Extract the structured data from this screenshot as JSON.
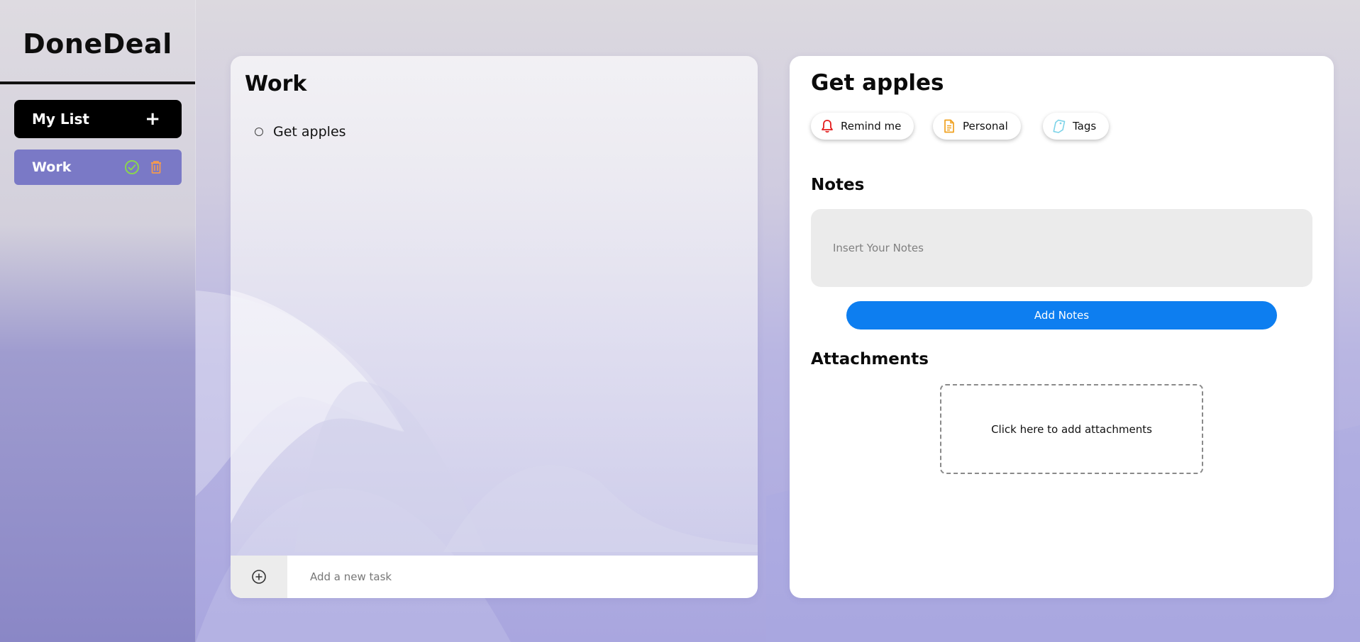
{
  "colors": {
    "sidebar_active": "#7a79c6",
    "primary_button": "#0d7ef0",
    "check_icon": "#8ad54f",
    "trash_icon": "#f39a4f",
    "bell_icon": "#e31b1b",
    "doc_icon": "#f0a120",
    "tag_icon": "#7dd3e8"
  },
  "app": {
    "brand": "DoneDeal"
  },
  "sidebar": {
    "mylist_label": "My List",
    "mylist_plus": "+",
    "lists": [
      {
        "label": "Work",
        "icons": [
          "check-circle-icon",
          "trash-icon"
        ]
      }
    ]
  },
  "tasks_panel": {
    "title": "Work",
    "tasks": [
      {
        "text": "Get apples",
        "done": false
      }
    ],
    "add_placeholder": "Add a new task",
    "add_icon": "plus-circle-icon"
  },
  "detail_panel": {
    "title": "Get apples",
    "chips": [
      {
        "label": "Remind me",
        "icon": "bell-icon"
      },
      {
        "label": "Personal",
        "icon": "document-icon"
      },
      {
        "label": "Tags",
        "icon": "tag-icon"
      }
    ],
    "notes_heading": "Notes",
    "notes_placeholder": "Insert Your Notes",
    "add_notes_label": "Add Notes",
    "attachments_heading": "Attachments",
    "attachments_prompt": "Click here to add attachments"
  }
}
